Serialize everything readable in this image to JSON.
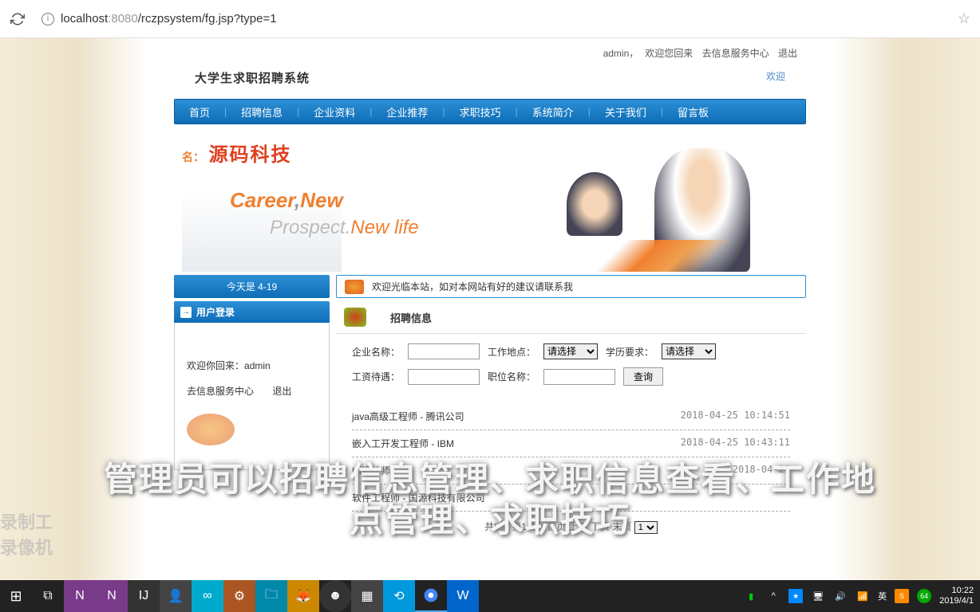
{
  "browser": {
    "url_host": "localhost",
    "url_port": ":8080",
    "url_path": "/rczpsystem/fg.jsp?type=1"
  },
  "header": {
    "user": "admin",
    "welcome_suffix": "欢迎您回来",
    "link_info_center": "去信息服务中心",
    "link_logout": "退出",
    "site_title": "大学生求职招聘系统",
    "welcome_tag": "欢迎"
  },
  "nav": [
    "首页",
    "招聘信息",
    "企业资料",
    "企业推荐",
    "求职技巧",
    "系统简介",
    "关于我们",
    "留言板"
  ],
  "banner": {
    "brand_label": "名：",
    "brand_name": "源码科技",
    "slogan_line1_a": "Career",
    "slogan_line1_b": "New",
    "slogan_line2_a": "Prospect.",
    "slogan_line2_b": "New life"
  },
  "infobar": {
    "date_label": "今天是 4-19",
    "marquee": "欢迎光临本站，如对本网站有好的建议请联系我"
  },
  "login_panel": {
    "title": "用户登录",
    "welcome_prefix": "欢迎你回来：",
    "username": "admin",
    "link_center": "去信息服务中心",
    "link_logout": "退出"
  },
  "section": {
    "title": "招聘信息"
  },
  "filters": {
    "company_label": "企业名称：",
    "location_label": "工作地点：",
    "location_placeholder": "请选择",
    "education_label": "学历要求：",
    "education_placeholder": "请选择",
    "salary_label": "工资待遇：",
    "position_label": "职位名称：",
    "query_btn": "查询"
  },
  "jobs": [
    {
      "title": "java高级工程师 - 腾讯公司",
      "date": "2018-04-25 10:14:51"
    },
    {
      "title": "嵌入工开发工程师 - IBM",
      "date": "2018-04-25 10:43:11"
    },
    {
      "title": "UI设计师",
      "date": "2018-04-25"
    },
    {
      "title": "软件工程师 - 国源科技有限公司",
      "date": ""
    }
  ],
  "pagination": {
    "total": "共5条",
    "page": "第1/2页",
    "first": "首页",
    "prev": "上页",
    "next": "下页",
    "last": "末页",
    "select_val": "1"
  },
  "subtitle": {
    "line1": "管理员可以招聘信息管理、求职信息查看、工作地",
    "line2": "点管理、求职技巧"
  },
  "watermark": "录制工\n录像机",
  "taskbar": {
    "time": "10:22",
    "date": "2019/4/1",
    "ime": "英",
    "badge": "64"
  }
}
